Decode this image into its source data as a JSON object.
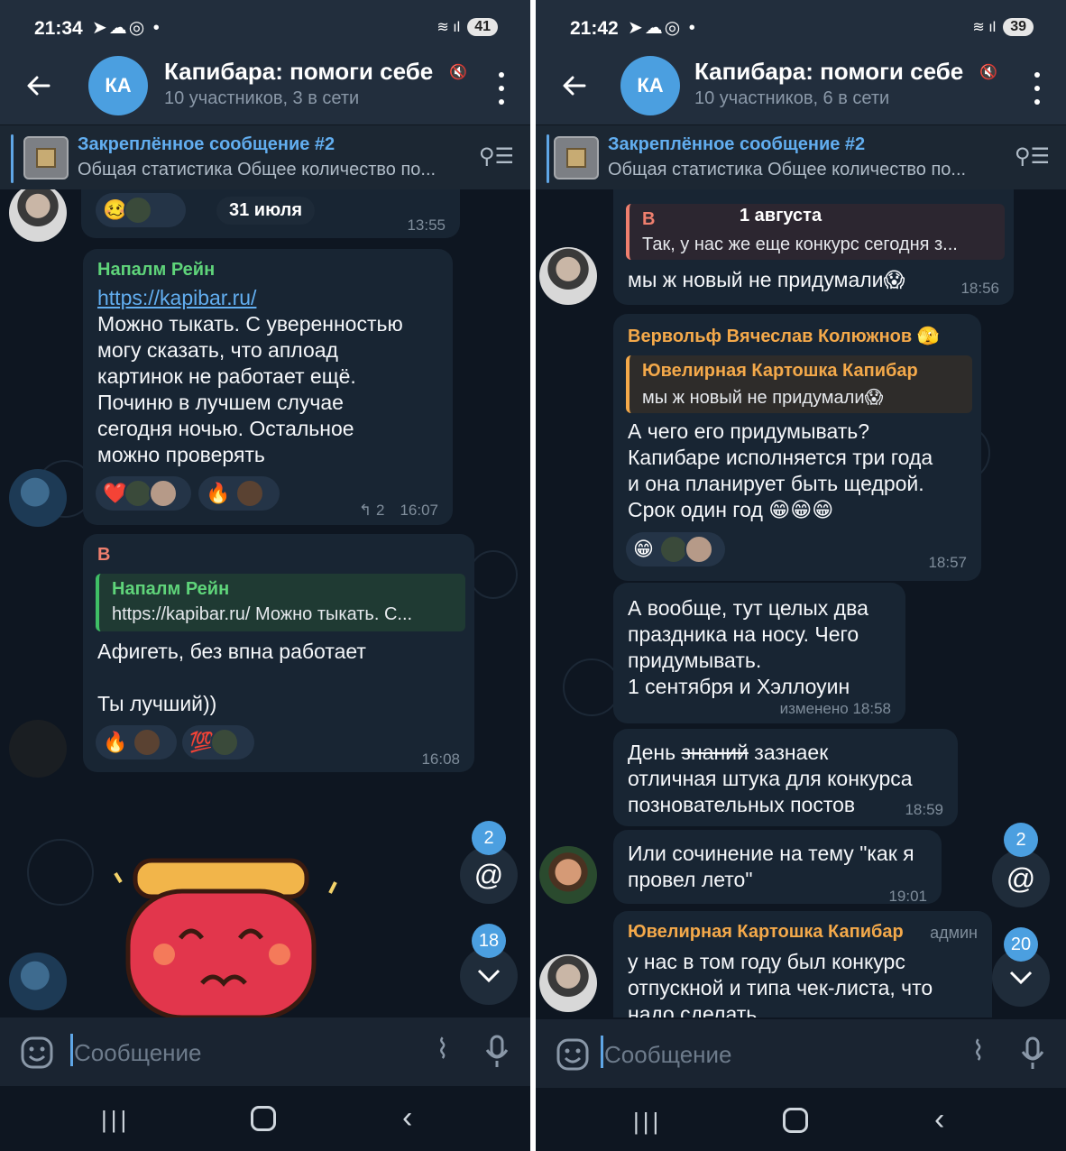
{
  "left": {
    "status": {
      "time": "21:34",
      "battery": "41"
    },
    "header": {
      "avatar_initials": "КА",
      "title": "Капибара: помоги себе",
      "subtitle": "10 участников, 3 в сети"
    },
    "pinned": {
      "title": "Закреплённое сообщение #2",
      "text": "Общая статистика Общее количество по..."
    },
    "messages": [
      {
        "date_label": "31 июля",
        "time": "13:55"
      },
      {
        "sender": "Напалм Рейн",
        "link": "https://kapibar.ru/",
        "text": "Можно тыкать. С уверенностью\nмогу сказать, что аплоад\nкартинок не работает ещё.\nПочиню в лучшем случае\nсегодня ночью. Остальное\nможно проверять",
        "replies": "↰ 2",
        "time": "16:07"
      },
      {
        "sender": "В",
        "reply_name": "Напалм Рейн",
        "reply_text": "https://kapibar.ru/ Можно тыкать. С...",
        "text": "Афигеть, без впна работает\n\nТы лучший))",
        "time": "16:08"
      }
    ],
    "fab_mentions": "2",
    "fab_unread": "18",
    "input_placeholder": "Сообщение"
  },
  "right": {
    "status": {
      "time": "21:42",
      "battery": "39"
    },
    "header": {
      "avatar_initials": "КА",
      "title": "Капибара: помоги себе",
      "subtitle": "10 участников, 6 в сети"
    },
    "pinned": {
      "title": "Закреплённое сообщение #2",
      "text": "Общая статистика Общее количество по..."
    },
    "messages": [
      {
        "reply_name": "В",
        "date_label": "1 августа",
        "reply_text": "Так, у нас же еще конкурс сегодня з...",
        "text": "мы ж новый не придумали😱",
        "time": "18:56"
      },
      {
        "sender": "Вервольф Вячеслав Колюжнов 🫣",
        "reply_name": "Ювелирная Картошка Капибар",
        "reply_text": "мы ж новый не придумали😱",
        "text": "А чего его придумывать?\nКапибаре исполняется три года\nи она планирует быть щедрой.\nСрок один год 😁😁😁",
        "time": "18:57"
      },
      {
        "text": "А вообще, тут целых два\nпраздника на носу. Чего\nпридумывать.\n1 сентября и Хэллоуин",
        "time": "изменено 18:58"
      },
      {
        "text_before": "День ",
        "strike": "знаний",
        "text_after": " зазнаек\nотличная штука для конкурса\nпознователь­ных постов",
        "time": "18:59"
      },
      {
        "text": "Или сочинение на тему \"как я\nпровел лето\"",
        "time": "19:01"
      },
      {
        "sender": "Ювелирная Картошка Капибар",
        "role": "админ",
        "text": "у нас в том году был конкурс\nотпускной и типа чек-листа, что\nнадо сделать"
      }
    ],
    "fab_mentions": "2",
    "fab_unread": "20",
    "input_placeholder": "Сообщение"
  },
  "colors": {
    "accent": "#4b9fe0",
    "bubble": "#182533",
    "sender_green": "#5fd47a",
    "sender_red": "#ef7f6e",
    "sender_orange": "#f4a94a"
  },
  "icons": [
    "back-arrow-icon",
    "mute-icon",
    "kebab-menu-icon",
    "pin-list-icon",
    "emoji-icon",
    "attach-icon",
    "mic-icon",
    "mention-icon",
    "chevron-down-icon"
  ]
}
